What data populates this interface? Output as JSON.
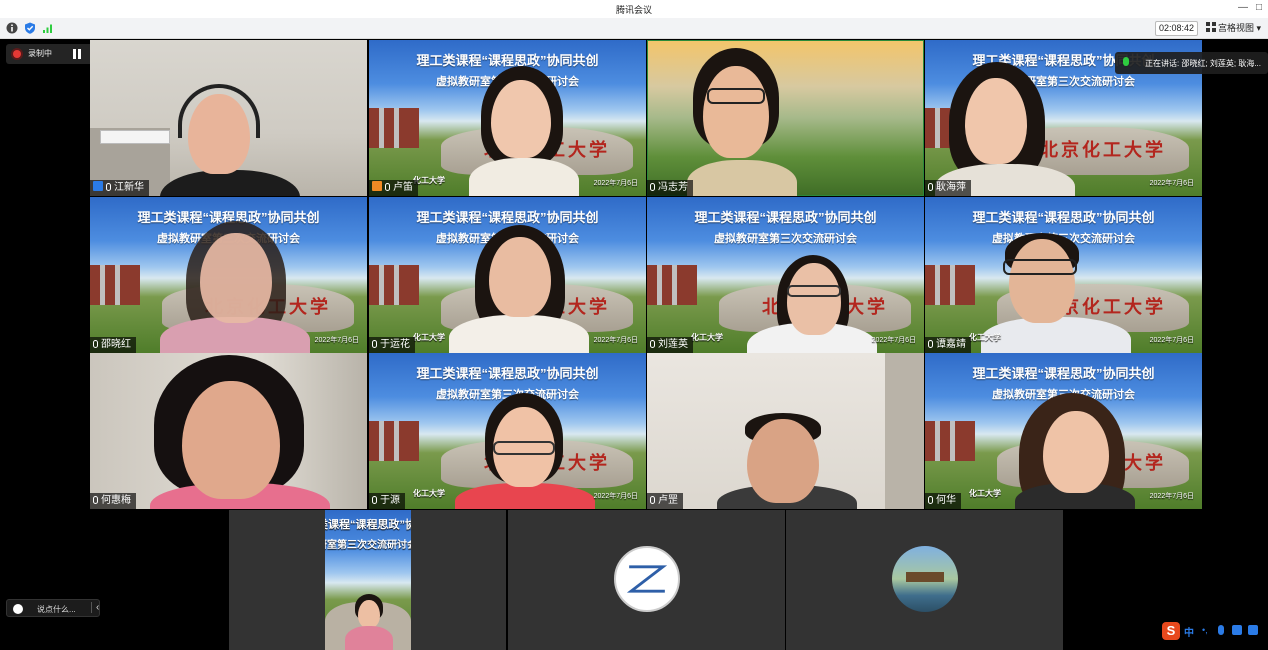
{
  "window": {
    "title": "腾讯会议",
    "minimize": "—",
    "restore": "□"
  },
  "toolbar": {
    "timer": "02:08:42",
    "view_label": "宫格视图",
    "view_arrow": "▾"
  },
  "recording": {
    "label": "录制中"
  },
  "speaking": {
    "text": "正在讲话: 邵晓红; 刘莲英; 耿海..."
  },
  "meeting_banner": {
    "line1": "理工类课程“课程思政”协同共创",
    "line2": "虚拟教研室第三次交流研讨会",
    "rock_text": "北京化工大学",
    "school_short": "化工大学",
    "date": "2022年7月6日"
  },
  "participants": [
    {
      "name": "江新华",
      "role": "host"
    },
    {
      "name": "卢笛",
      "role": "cohost"
    },
    {
      "name": "冯志芳"
    },
    {
      "name": "耿海萍"
    },
    {
      "name": "邵晓红"
    },
    {
      "name": "于运花"
    },
    {
      "name": "刘莲英"
    },
    {
      "name": "谭嘉靖"
    },
    {
      "name": "何惠梅"
    },
    {
      "name": "于源"
    },
    {
      "name": "卢罡"
    },
    {
      "name": "何华"
    }
  ],
  "chat": {
    "placeholder": "说点什么..."
  },
  "ime": {
    "lang": "中"
  },
  "colors": {
    "mic_active": "#2ecc40",
    "host_badge": "#2b7be6",
    "cohost_badge": "#f08a24",
    "record_dot": "#e53935"
  }
}
